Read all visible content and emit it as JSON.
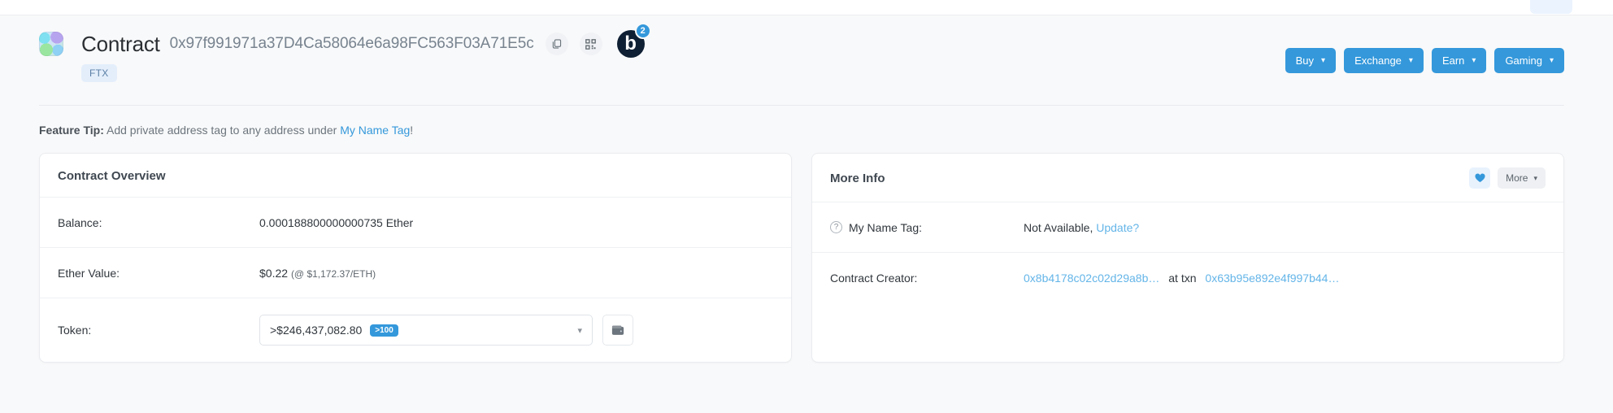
{
  "header": {
    "title": "Contract",
    "address": "0x97f991971a37D4Ca58064e6a98FC563F03A71E5c",
    "copy_icon": "copy-icon",
    "qr_icon": "qrcode-icon",
    "logo_letter": "b",
    "logo_badge_count": "2",
    "label_tag": "FTX",
    "nav_buttons": [
      {
        "label": "Buy",
        "caret": "▾"
      },
      {
        "label": "Exchange",
        "caret": "▾"
      },
      {
        "label": "Earn",
        "caret": "▾"
      },
      {
        "label": "Gaming",
        "caret": "▾"
      }
    ]
  },
  "tip": {
    "prefix": "Feature Tip:",
    "text": "Add private address tag to any address under",
    "link": "My Name Tag",
    "suffix": "!"
  },
  "overview": {
    "title": "Contract Overview",
    "balance_label": "Balance:",
    "balance_value": "0.000188800000000735 Ether",
    "ether_value_label": "Ether Value:",
    "ether_value": "$0.22",
    "ether_rate": "(@ $1,172.37/ETH)",
    "token_label": "Token:",
    "token_amount": ">$246,437,082.80",
    "token_badge": ">100",
    "token_caret": "▾",
    "wallet_icon": "wallet-icon"
  },
  "more_info": {
    "title": "More Info",
    "heart_icon": "heart-icon",
    "more_label": "More",
    "more_caret": "▾",
    "name_tag_label": "My Name Tag:",
    "name_tag_help": "?",
    "name_tag_value": "Not Available,",
    "name_tag_update": "Update?",
    "creator_label": "Contract Creator:",
    "creator_address": "0x8b4178c02c02d29a8b…",
    "at_txn": "at txn",
    "creator_txn": "0x63b95e892e4f997b44…"
  },
  "colors": {
    "accent": "#3498db",
    "link": "#64b5e8",
    "page_bg": "#f8f9fa",
    "logo_dark": "#0f2034"
  }
}
